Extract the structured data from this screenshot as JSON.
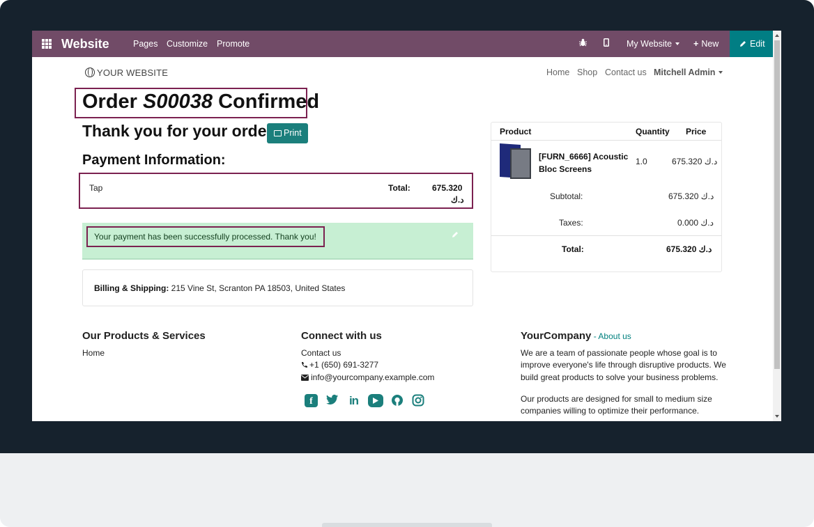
{
  "topbar": {
    "brand": "Website",
    "menu": [
      "Pages",
      "Customize",
      "Promote"
    ],
    "website_switcher": "My Website",
    "new_label": "New",
    "edit_label": "Edit"
  },
  "site": {
    "logo_text": "YOUR WEBSITE",
    "nav": [
      "Home",
      "Shop",
      "Contact us"
    ],
    "user": "Mitchell Admin"
  },
  "order": {
    "title_prefix": "Order",
    "number": "S00038",
    "title_suffix": "Confirmed",
    "thanks": "Thank you for your order.",
    "print_label": "Print",
    "payment_heading": "Payment Information:",
    "payment_method": "Tap",
    "total_label": "Total:",
    "total_value": "675.320",
    "currency": "د.ك",
    "success_message": "Your payment has been successfully processed. Thank you!",
    "billing_label": "Billing & Shipping:",
    "billing_address": "215 Vine St, Scranton PA 18503, United States"
  },
  "summary": {
    "headers": {
      "product": "Product",
      "quantity": "Quantity",
      "price": "Price"
    },
    "product_name_line1": "[FURN_6666] Acoustic",
    "product_name_line2": "Bloc Screens",
    "quantity": "1.0",
    "price": "675.320 د.ك",
    "subtotal_label": "Subtotal:",
    "subtotal": "675.320 د.ك",
    "taxes_label": "Taxes:",
    "taxes": "0.000 د.ك",
    "total_label": "Total:",
    "total": "675.320 د.ك"
  },
  "footer": {
    "col1_heading": "Our Products & Services",
    "col1_link": "Home",
    "col2_heading": "Connect with us",
    "col2_link": "Contact us",
    "phone": "+1 (650) 691-3277",
    "email": "info@yourcompany.example.com",
    "col3_heading": "YourCompany",
    "col3_sep": " - ",
    "col3_link": "About us",
    "about_lines": [
      "We are a team of passionate people whose goal is to",
      "improve everyone's life through disruptive products. We",
      "build great products to solve your business problems."
    ],
    "about2_lines": [
      "Our products are designed for small to medium size",
      "companies willing to optimize their performance."
    ]
  },
  "colors": {
    "topbar": "#714b67",
    "accent": "#017e84",
    "highlight": "#7b2150",
    "alert_bg": "#c7efd3"
  },
  "icons": [
    "apps-grid-icon",
    "bug-icon",
    "mobile-icon",
    "plus-icon",
    "pencil-icon",
    "globe-icon",
    "printer-icon",
    "phone-icon",
    "envelope-icon",
    "facebook-icon",
    "twitter-icon",
    "linkedin-icon",
    "youtube-icon",
    "github-icon",
    "instagram-icon"
  ]
}
